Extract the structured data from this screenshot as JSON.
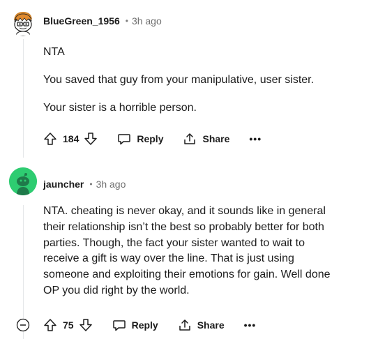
{
  "comments": [
    {
      "author": "BlueGreen_1956",
      "separator": "•",
      "time": "3h ago",
      "paragraphs": [
        "NTA",
        "You saved that guy from your manipulative, user sister.",
        "Your sister is a horrible person."
      ],
      "votes": "184",
      "reply_label": "Reply",
      "share_label": "Share",
      "more_label": "•••"
    },
    {
      "author": "jauncher",
      "separator": "•",
      "time": "3h ago",
      "lines": [
        "NTA. cheating is never okay, and it sounds like in general",
        "their relationship isn’t the best so probably better for both",
        "parties. Though, the fact your sister wanted to wait to",
        "receive a gift is way over the line. That is just using",
        "someone and exploiting their emotions for gain. Well done",
        "OP you did right by the world."
      ],
      "votes": "75",
      "reply_label": "Reply",
      "share_label": "Share",
      "more_label": "•••"
    }
  ],
  "colors": {
    "accent_green": "#2ecc71",
    "text": "#1c1c1c",
    "meta": "#6f6f6f"
  },
  "icons": [
    "upvote-icon",
    "downvote-icon",
    "reply-icon",
    "share-icon",
    "more-icon",
    "collapse-icon"
  ]
}
